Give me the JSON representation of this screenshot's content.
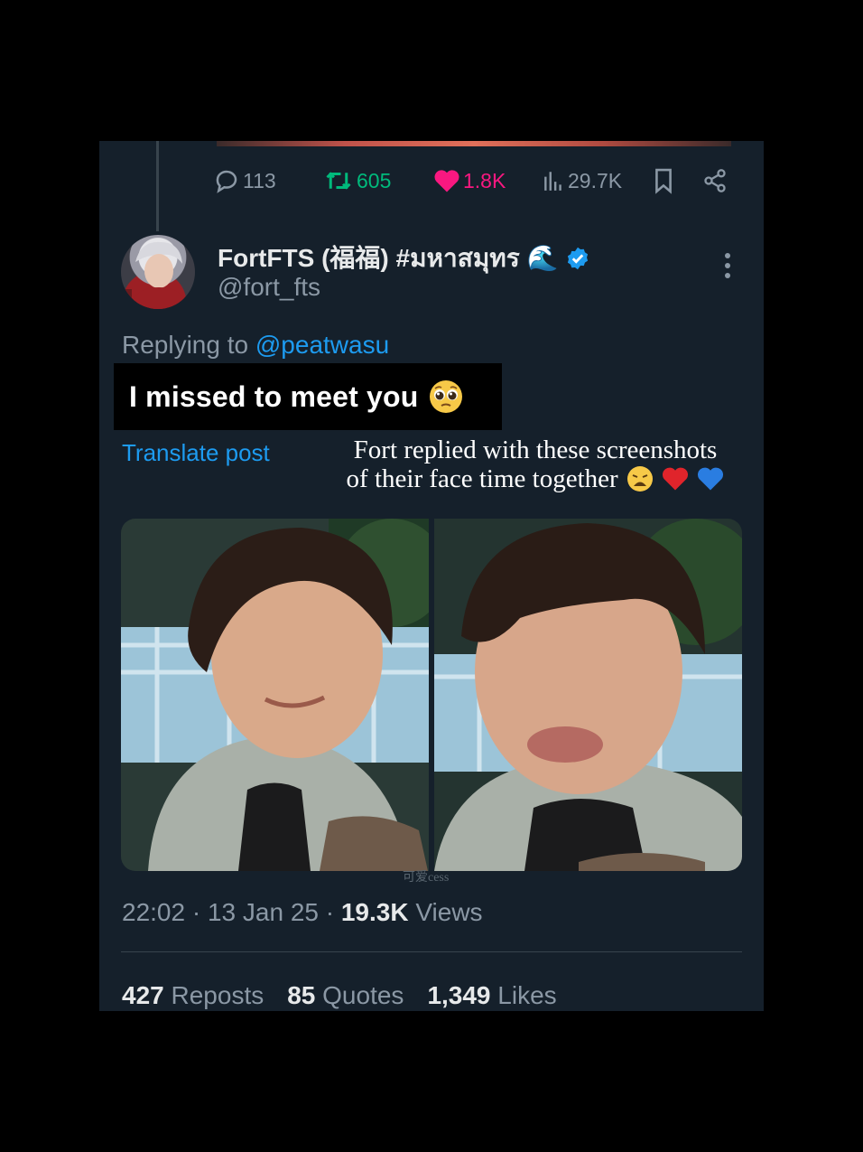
{
  "prev_tweet": {
    "replies": "113",
    "reposts": "605",
    "likes": "1.8K",
    "views": "29.7K"
  },
  "tweet": {
    "display_name": "FortFTS (福福) #มหาสมุทร 🌊",
    "handle": "@fort_fts",
    "replying_prefix": "Replying to",
    "replying_to": "@peatwasu",
    "text": "I missed to meet you",
    "translate_label": "Translate post",
    "time": "22:02",
    "date": "13 Jan 25",
    "views_count": "19.3K",
    "views_label": "Views",
    "reposts_count": "427",
    "reposts_label": "Reposts",
    "quotes_count": "85",
    "quotes_label": "Quotes",
    "likes_count": "1,349",
    "likes_label": "Likes"
  },
  "overlay": {
    "caption_line1": "Fort replied with these screenshots",
    "caption_line2": "of their face time together",
    "watermark": "可爱cess"
  },
  "colors": {
    "background": "#15202b",
    "accent_blue": "#1d9bf0",
    "repost_green": "#00ba7c",
    "like_pink": "#f91880",
    "muted": "#8b98a5"
  }
}
